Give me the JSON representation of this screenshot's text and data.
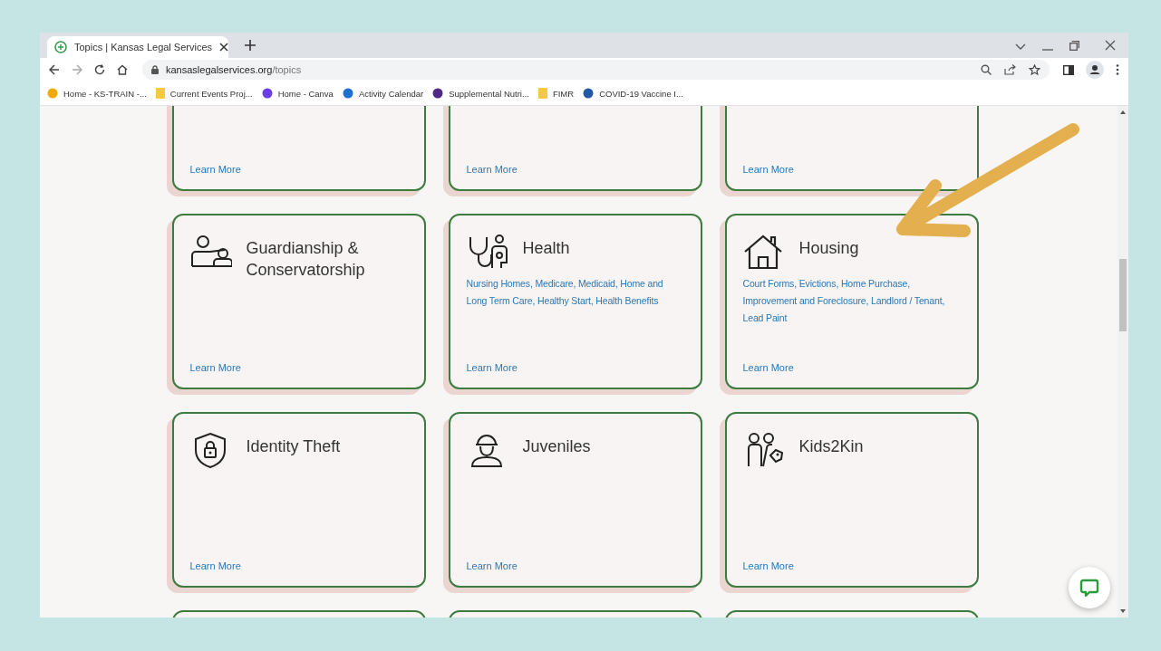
{
  "browser": {
    "tabs": [
      {
        "title": "Topics | Kansas Legal Services",
        "selected": true
      }
    ],
    "address": {
      "domain": "kansaslegalservices.org",
      "path": "/topics"
    },
    "bookmarks": [
      {
        "label": "Home - KS-TRAIN -...",
        "kind": "site",
        "color": "#f2a900"
      },
      {
        "label": "Current Events Proj...",
        "kind": "folder",
        "color": "#f6c945"
      },
      {
        "label": "Home - Canva",
        "kind": "site",
        "color": "#6a3de8"
      },
      {
        "label": "Activity Calendar",
        "kind": "site",
        "color": "#1d6fd1"
      },
      {
        "label": "Supplemental Nutri...",
        "kind": "site",
        "color": "#512888"
      },
      {
        "label": "FIMR",
        "kind": "folder",
        "color": "#f6c945"
      },
      {
        "label": "COVID-19 Vaccine I...",
        "kind": "site",
        "color": "#2457a6"
      }
    ]
  },
  "cards": [
    {
      "kind": "cut_top",
      "link": "Learn More"
    },
    {
      "kind": "cut_top",
      "link": "Learn More"
    },
    {
      "kind": "cut_top",
      "link": "Learn More"
    },
    {
      "kind": "full",
      "title": "Guardianship & Conservatorship",
      "link": "Learn More"
    },
    {
      "kind": "full",
      "title": "Health",
      "topics": "Nursing Homes, Medicare, Medicaid, Home and Long Term Care, Healthy Start, Health Benefits",
      "link": "Learn More"
    },
    {
      "kind": "full",
      "title": "Housing",
      "topics": "Court Forms, Evictions, Home Purchase, Improvement and Foreclosure, Landlord / Tenant, Lead Paint",
      "link": "Learn More"
    },
    {
      "kind": "full",
      "title": "Identity Theft",
      "link": "Learn More"
    },
    {
      "kind": "full",
      "title": "Juveniles",
      "link": "Learn More"
    },
    {
      "kind": "full",
      "title": "Kids2Kin",
      "link": "Learn More"
    },
    {
      "kind": "cut_bottom"
    },
    {
      "kind": "cut_bottom"
    },
    {
      "kind": "cut_bottom"
    }
  ]
}
